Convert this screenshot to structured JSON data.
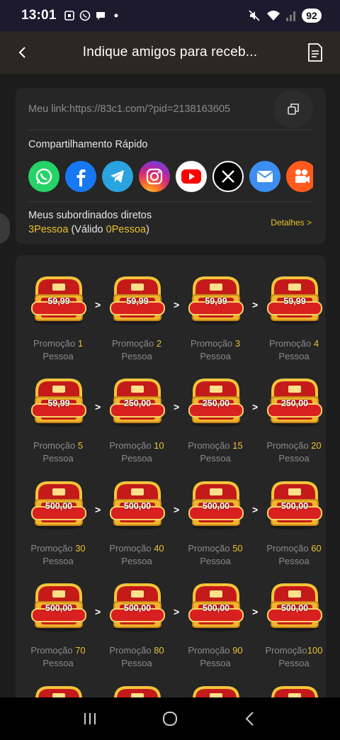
{
  "status_bar": {
    "time": "13:01",
    "battery": "92"
  },
  "header": {
    "title": "Indique amigos para receb..."
  },
  "link_card": {
    "link_label": "Meu link:https://83c1.com/?pid=2138163605",
    "share_title": "Compartilhamento Rápido",
    "share_icons": [
      "whatsapp-icon",
      "facebook-icon",
      "telegram-icon",
      "instagram-icon",
      "youtube-icon",
      "x-icon",
      "email-icon",
      "kwai-icon"
    ],
    "subordinates_title": "Meus subordinados diretos",
    "sub_count": "3Pessoa",
    "sub_valid_open": " (Válido ",
    "sub_valid_count": "0Pessoa",
    "sub_valid_close": ")",
    "details": "Detalhes >"
  },
  "rewards": [
    {
      "amount": "59,99",
      "promo": "Promoção ",
      "n": "1",
      "unit": "Pessoa"
    },
    {
      "amount": "59,99",
      "promo": "Promoção ",
      "n": "2",
      "unit": "Pessoa"
    },
    {
      "amount": "59,99",
      "promo": "Promoção ",
      "n": "3",
      "unit": "Pessoa"
    },
    {
      "amount": "59,99",
      "promo": "Promoção ",
      "n": "4",
      "unit": "Pessoa"
    },
    {
      "amount": "59,99",
      "promo": "Promoção ",
      "n": "5",
      "unit": "Pessoa"
    },
    {
      "amount": "250,00",
      "promo": "Promoção ",
      "n": "10",
      "unit": "Pessoa"
    },
    {
      "amount": "250,00",
      "promo": "Promoção ",
      "n": "15",
      "unit": "Pessoa"
    },
    {
      "amount": "250,00",
      "promo": "Promoção ",
      "n": "20",
      "unit": "Pessoa"
    },
    {
      "amount": "500,00",
      "promo": "Promoção ",
      "n": "30",
      "unit": "Pessoa"
    },
    {
      "amount": "500,00",
      "promo": "Promoção ",
      "n": "40",
      "unit": "Pessoa"
    },
    {
      "amount": "500,00",
      "promo": "Promoção ",
      "n": "50",
      "unit": "Pessoa"
    },
    {
      "amount": "500,00",
      "promo": "Promoção ",
      "n": "60",
      "unit": "Pessoa"
    },
    {
      "amount": "500,00",
      "promo": "Promoção ",
      "n": "70",
      "unit": "Pessoa"
    },
    {
      "amount": "500,00",
      "promo": "Promoção ",
      "n": "80",
      "unit": "Pessoa"
    },
    {
      "amount": "500,00",
      "promo": "Promoção ",
      "n": "90",
      "unit": "Pessoa"
    },
    {
      "amount": "500,00",
      "promo": "Promoção",
      "n": "100",
      "unit": " Pessoa"
    }
  ],
  "arrow": ">",
  "colors": {
    "accent": "#e9c02e",
    "card": "#262626",
    "background": "#1c1c1c"
  }
}
